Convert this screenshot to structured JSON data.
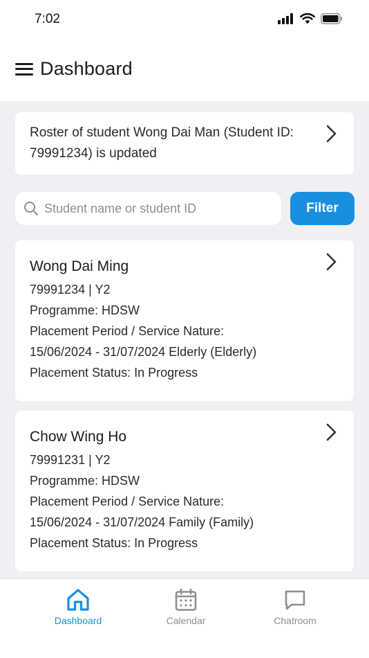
{
  "status_bar": {
    "time": "7:02"
  },
  "header": {
    "title": "Dashboard"
  },
  "notice": {
    "text": "Roster of student Wong Dai Man (Student ID: 79991234)  is updated"
  },
  "search": {
    "placeholder": "Student name or student ID",
    "value": ""
  },
  "filter": {
    "label": "Filter"
  },
  "students": [
    {
      "name": "Wong Dai Ming",
      "id_year": "79991234 | Y2",
      "programme": "Programme: HDSW",
      "period_label": "Placement Period / Service Nature:",
      "period_value": "15/06/2024 - 31/07/2024 Elderly (Elderly)",
      "status": "Placement Status: In Progress"
    },
    {
      "name": "Chow Wing Ho",
      "id_year": "79991231 | Y2",
      "programme": "Programme: HDSW",
      "period_label": "Placement Period / Service Nature:",
      "period_value": "15/06/2024 - 31/07/2024 Family (Family)",
      "status": "Placement Status: In Progress"
    }
  ],
  "nav": {
    "items": [
      {
        "label": "Dashboard",
        "icon": "home-icon",
        "active": true
      },
      {
        "label": "Calendar",
        "icon": "calendar-icon",
        "active": false
      },
      {
        "label": "Chatroom",
        "icon": "chat-icon",
        "active": false
      }
    ]
  },
  "colors": {
    "accent": "#1a8fe0",
    "inactive": "#8e8e93",
    "background": "#eef0f3"
  }
}
